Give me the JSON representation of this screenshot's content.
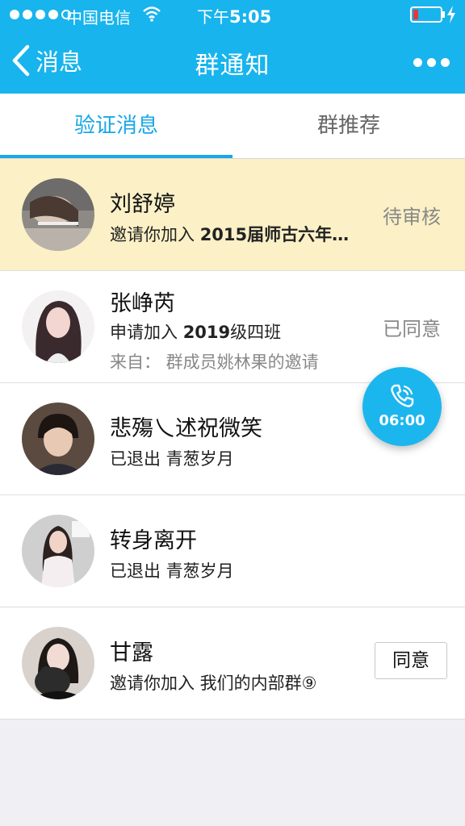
{
  "status_bar": {
    "carrier": "中国电信",
    "time_prefix": "下午",
    "time": "5:05"
  },
  "nav": {
    "back_label": "消息",
    "title": "群通知"
  },
  "tabs": [
    {
      "label": "验证消息",
      "active": true
    },
    {
      "label": "群推荐",
      "active": false
    }
  ],
  "notifications": [
    {
      "name": "刘舒婷",
      "action": "邀请你加入 ",
      "year": "2015",
      "group": "届师古六年…",
      "status": "待审核"
    },
    {
      "name": "张峥芮",
      "action": "申请加入 ",
      "year": "2019",
      "group": "级四班",
      "source": "来自：  群成员姚林果的邀请",
      "status": "已同意"
    },
    {
      "name": "悲殤乀述祝微笑",
      "detail": "已退出 青葱岁月"
    },
    {
      "name": "转身离开",
      "detail": "已退出 青葱岁月"
    },
    {
      "name": "甘露",
      "detail": "邀请你加入 我们的内部群⑨",
      "button": "同意"
    }
  ],
  "call": {
    "timer": "06:00"
  },
  "colors": {
    "header": "#18b4ed",
    "accent": "#19a7e6",
    "highlight_row": "#fbf0c6"
  }
}
